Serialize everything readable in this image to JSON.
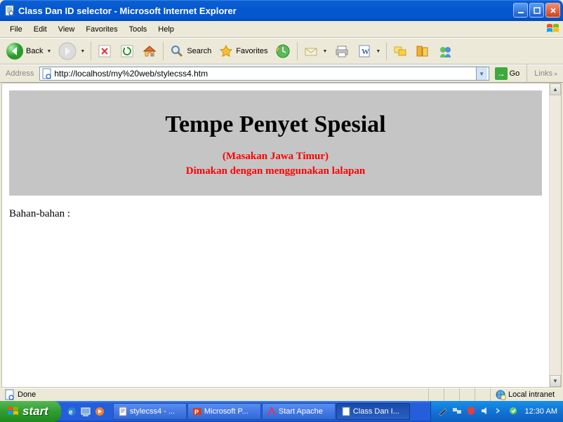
{
  "window": {
    "title": "Class Dan ID selector - Microsoft Internet Explorer"
  },
  "menu": {
    "items": [
      "File",
      "Edit",
      "View",
      "Favorites",
      "Tools",
      "Help"
    ]
  },
  "toolbar": {
    "back": "Back",
    "search": "Search",
    "favorites": "Favorites"
  },
  "address": {
    "label": "Address",
    "url": "http://localhost/my%20web/stylecss4.htm",
    "go": "Go",
    "links": "Links"
  },
  "page": {
    "heading": "Tempe Penyet Spesial",
    "sub1": "(Masakan Jawa Timur)",
    "sub2": "Dimakan dengan menggunakan lalapan",
    "section": "Bahan-bahan :"
  },
  "status": {
    "done": "Done",
    "zone": "Local intranet"
  },
  "taskbar": {
    "start": "start",
    "tasks": [
      {
        "label": "stylecss4 - ..."
      },
      {
        "label": "Microsoft P..."
      },
      {
        "label": "Start Apache"
      },
      {
        "label": "Class Dan I..."
      }
    ],
    "clock": "12:30 AM"
  }
}
